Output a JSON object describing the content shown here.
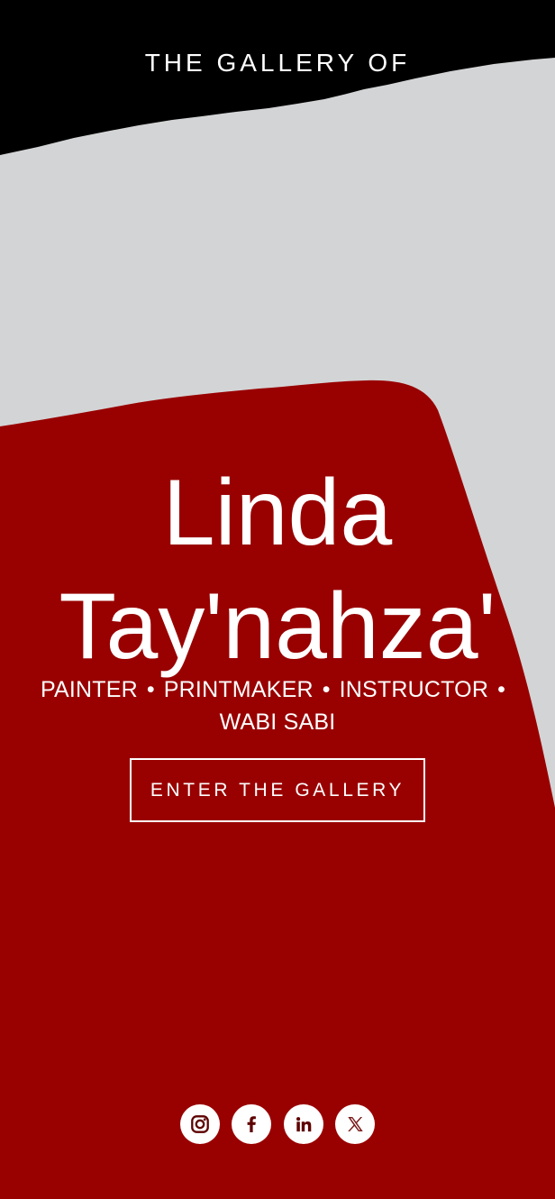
{
  "hero": {
    "eyebrow": "THE GALLERY OF",
    "name_line_1": "Linda",
    "name_line_2": "Tay'nahza'",
    "roles": {
      "painter": "PAINTER",
      "printmaker": "PRINTMAKER",
      "instructor": "INSTRUCTOR",
      "wabi_sabi": "WABI SABI",
      "separator": "•"
    },
    "cta_label": "ENTER THE GALLERY",
    "colors": {
      "black": "#000000",
      "light_gray": "#d3d4d5",
      "deep_red": "#990000",
      "white": "#ffffff"
    }
  },
  "social": {
    "icons": [
      "instagram-icon",
      "facebook-icon",
      "linkedin-icon",
      "x-icon"
    ]
  }
}
